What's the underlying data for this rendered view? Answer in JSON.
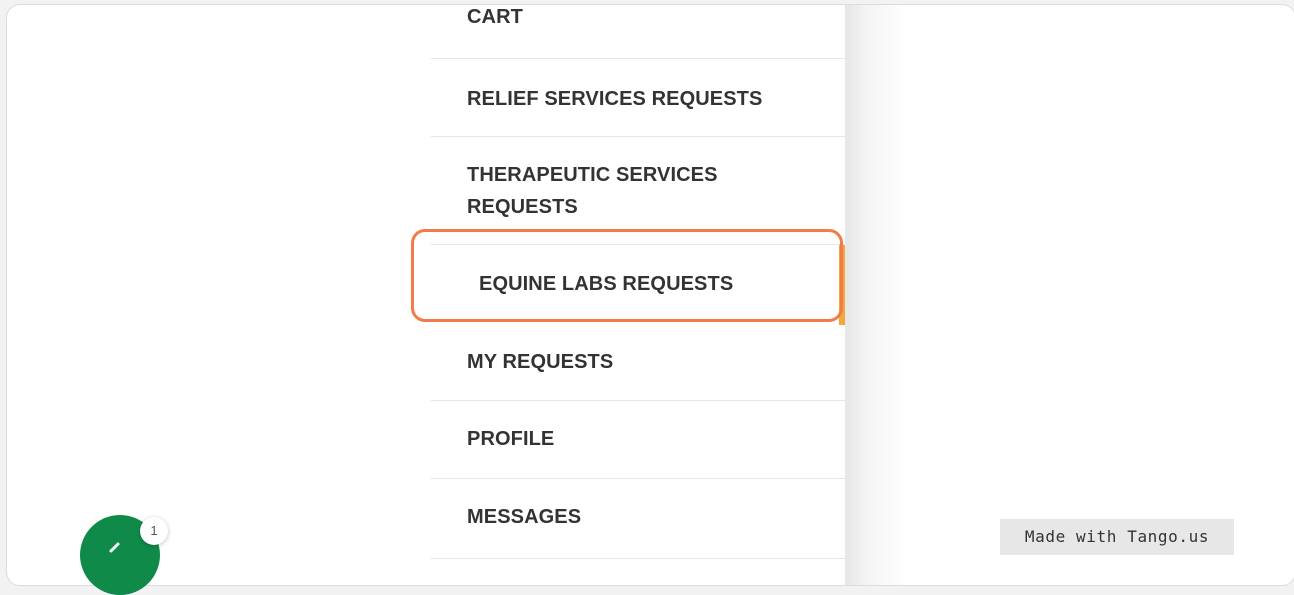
{
  "menu": {
    "items": [
      {
        "label": "CART"
      },
      {
        "label": "RELIEF SERVICES REQUESTS"
      },
      {
        "label": "THERAPEUTIC SERVICES REQUESTS"
      },
      {
        "label": "EQUINE LABS REQUESTS",
        "active": true
      },
      {
        "label": "MY REQUESTS"
      },
      {
        "label": "PROFILE"
      },
      {
        "label": "MESSAGES"
      }
    ]
  },
  "chat": {
    "badge_count": "1",
    "icon": "chat-icon",
    "color": "#0f8a49"
  },
  "watermark": {
    "text": "Made with Tango.us"
  },
  "colors": {
    "highlight": "#f4794b",
    "active_indicator": "#f2a93b",
    "text": "#333333"
  }
}
